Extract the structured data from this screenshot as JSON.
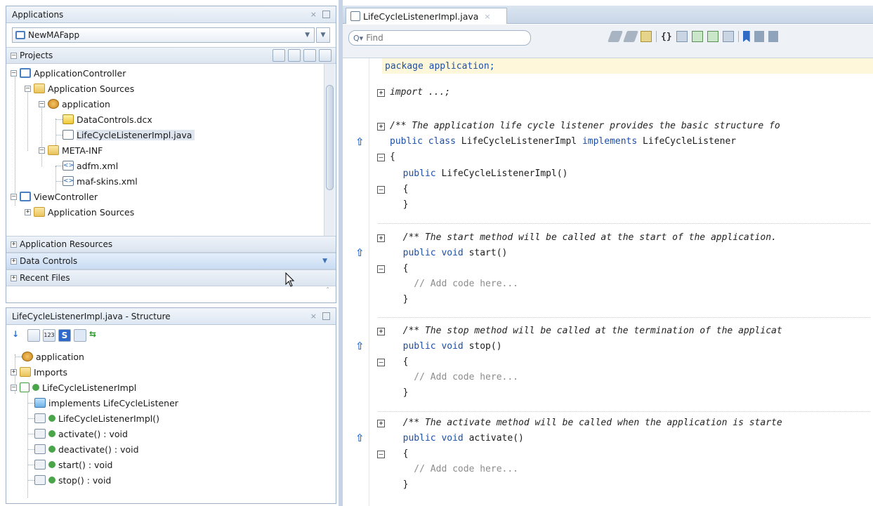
{
  "applications_panel": {
    "title": "Applications",
    "close_glyph": "×",
    "min_glyph": "–",
    "app_selector_value": "NewMAFapp",
    "projects_label": "Projects",
    "tree": [
      {
        "label": "ApplicationController",
        "icon": "project-icon"
      },
      {
        "label": "Application Sources",
        "icon": "folder-icon"
      },
      {
        "label": "application",
        "icon": "package-icon"
      },
      {
        "label": "DataControls.dcx",
        "icon": "dcx-file-icon"
      },
      {
        "label": "LifeCycleListenerImpl.java",
        "icon": "java-file-icon",
        "selected": true
      },
      {
        "label": "META-INF",
        "icon": "folder-icon"
      },
      {
        "label": "adfm.xml",
        "icon": "xml-file-icon"
      },
      {
        "label": "maf-skins.xml",
        "icon": "xml-file-icon"
      },
      {
        "label": "ViewController",
        "icon": "project-icon"
      },
      {
        "label": "Application Sources",
        "icon": "folder-icon"
      }
    ],
    "sections": [
      "Application Resources",
      "Data Controls",
      "Recent Files"
    ]
  },
  "structure_panel": {
    "title": "LifeCycleListenerImpl.java - Structure",
    "close_glyph": "×",
    "min_glyph": "–",
    "tree": [
      {
        "label": "application",
        "icon": "package-icon"
      },
      {
        "label": "Imports",
        "icon": "folder-icon"
      },
      {
        "label": "LifeCycleListenerImpl",
        "icon": "class-icon"
      },
      {
        "label": "implements LifeCycleListener",
        "icon": "implements-icon"
      },
      {
        "label": "LifeCycleListenerImpl()",
        "icon": "constructor-icon"
      },
      {
        "label": "activate() : void",
        "icon": "method-icon"
      },
      {
        "label": "deactivate() : void",
        "icon": "method-icon"
      },
      {
        "label": "start() : void",
        "icon": "method-icon"
      },
      {
        "label": "stop() : void",
        "icon": "method-icon"
      }
    ]
  },
  "editor": {
    "tab_label": "LifeCycleListenerImpl.java",
    "tab_close": "×",
    "find_placeholder": "Find",
    "lines": {
      "l1": "package application;",
      "l2": "import ...;",
      "l3": "/** The application life cycle listener provides the basic structure fo",
      "l4a": "public class",
      "l4b": " LifeCycleListenerImpl ",
      "l4c": "implements",
      "l4d": " LifeCycleListener",
      "l5": "{",
      "l6a": "  public",
      "l6b": " LifeCycleListenerImpl()",
      "l7": "  {",
      "l8": "  }",
      "l9": "  /** The start method will be called at the start of the application.",
      "l10a": "  public void",
      "l10b": " start()",
      "l11": "  {",
      "l12": "    // Add code here...",
      "l13": "  }",
      "l14": "  /** The stop method will be called at the termination of the applicat",
      "l15a": "  public void",
      "l15b": " stop()",
      "l16": "  {",
      "l17": "    // Add code here...",
      "l18": "  }",
      "l19": "  /** The activate method will be called when the application is starte",
      "l20a": "  public void",
      "l20b": " activate()",
      "l21": "  {",
      "l22": "    // Add code here...",
      "l23": "  }"
    }
  }
}
